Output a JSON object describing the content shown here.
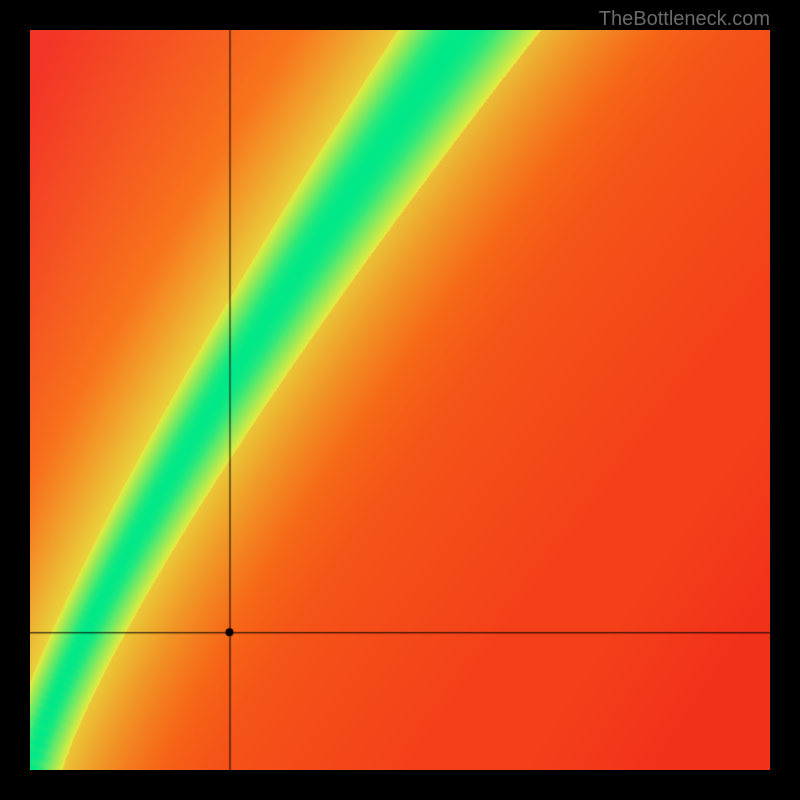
{
  "watermark": "TheBottleneck.com",
  "chart_data": {
    "type": "heatmap",
    "title": "",
    "xlabel": "",
    "ylabel": "",
    "xlim": [
      0,
      1
    ],
    "ylim": [
      0,
      1
    ],
    "crosshair": {
      "x": 0.27,
      "y": 0.185
    },
    "optimal_curve_description": "A green diagonal band from bottom-left to upper-middle region (steeper than y=x, curving upward), representing balanced component pairing. Colors transition from green (optimal) through yellow to red/orange (bottleneck) based on distance from this curve.",
    "color_stops": {
      "optimal": "#00e888",
      "near": "#e8ea3f",
      "warm": "#fca413",
      "far_upper_left": "#f11f2b",
      "far_lower_right": "#f2311a"
    },
    "marker": {
      "x": 0.27,
      "y": 0.185,
      "label": ""
    }
  }
}
